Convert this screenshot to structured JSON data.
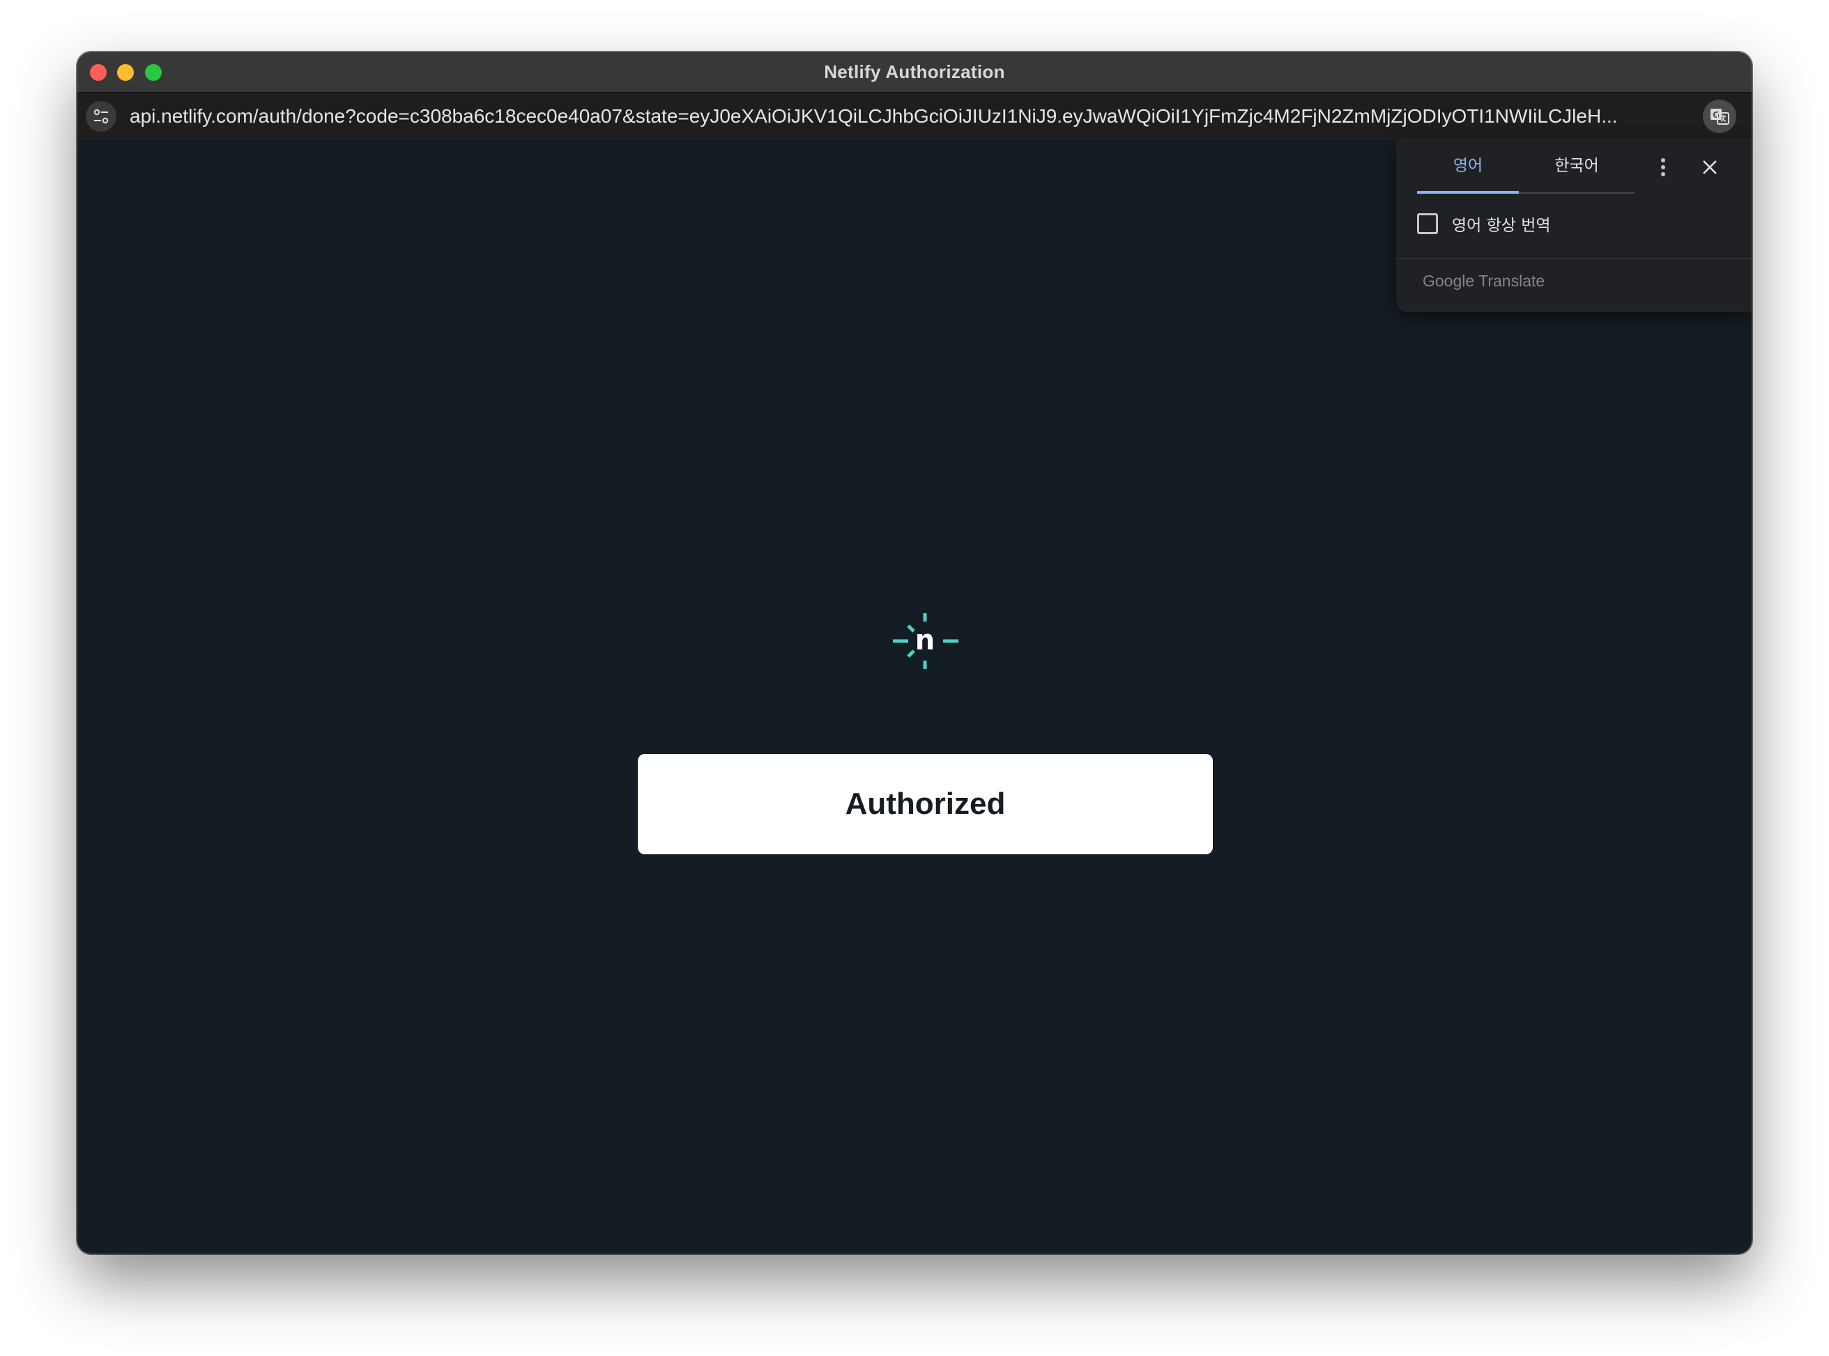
{
  "window": {
    "title": "Netlify Authorization"
  },
  "address_bar": {
    "url": "api.netlify.com/auth/done?code=c308ba6c18cec0e40a07&state=eyJ0eXAiOiJKV1QiLCJhbGciOiJIUzI1NiJ9.eyJwaWQiOiI1YjFmZjc4M2FjN2ZmMjZjODIyOTI1NWIiLCJleH..."
  },
  "page": {
    "logo_letter": "n",
    "status": "Authorized"
  },
  "translate_popup": {
    "tabs": [
      "영어",
      "한국어"
    ],
    "always_translate_label": "영어 항상 번역",
    "brand": "Google Translate"
  },
  "colors": {
    "background": "#141d24",
    "logo_accent": "#4fd1c5",
    "tab_active": "#8ab4f8"
  }
}
